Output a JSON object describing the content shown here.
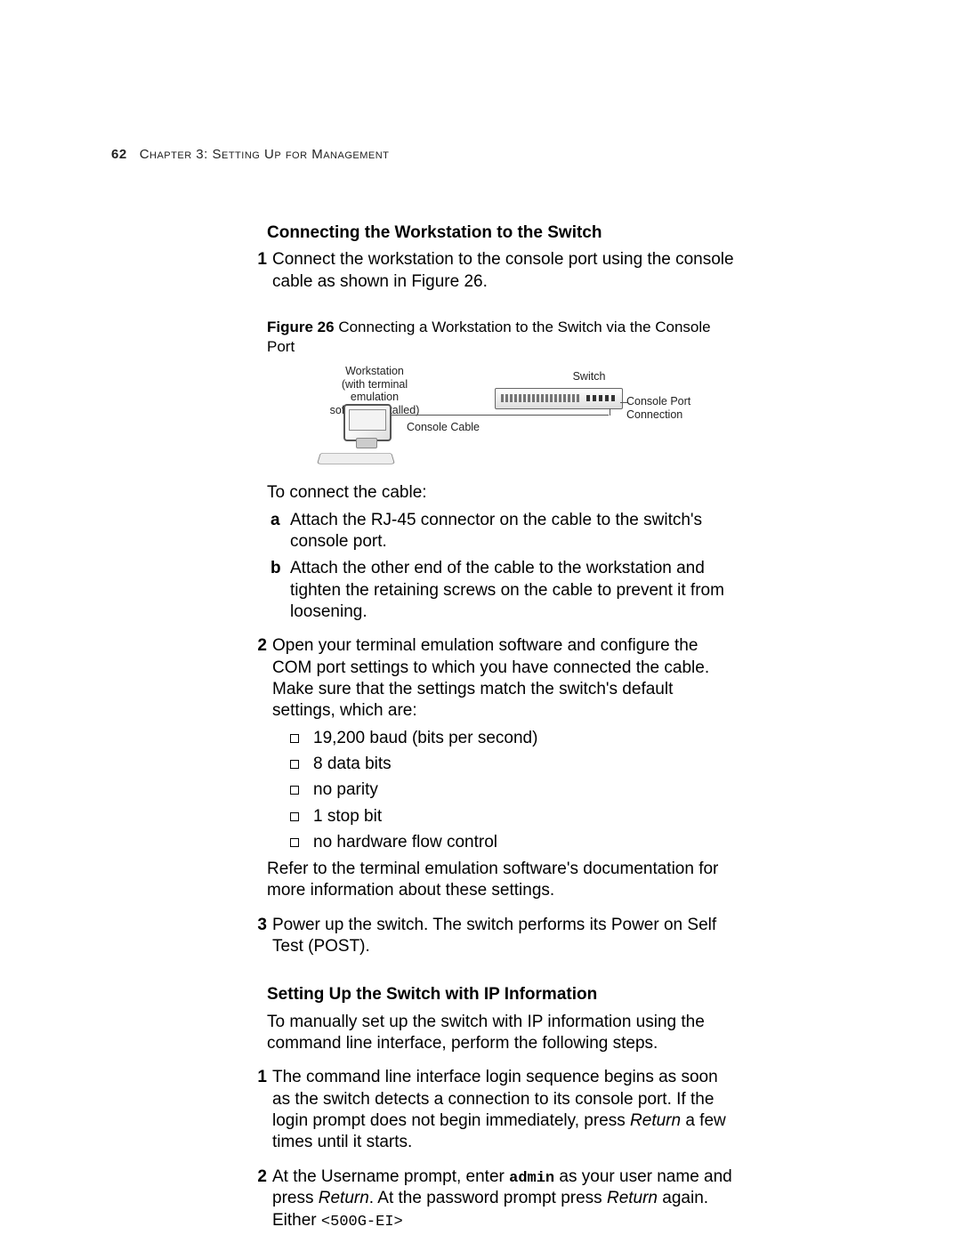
{
  "page_number": "62",
  "running_head": "Chapter 3: Setting Up for Management",
  "section1_title": "Connecting the Workstation to the Switch",
  "step1_num": "1",
  "step1_text": "Connect the workstation to the console port using the console cable as shown in Figure 26.",
  "fig_label": "Figure 26",
  "fig_caption": "   Connecting a Workstation to the Switch via the Console Port",
  "fig_workstation_l1": "Workstation",
  "fig_workstation_l2": "(with terminal emulation",
  "fig_workstation_l3": "software installed)",
  "fig_switch": "Switch",
  "fig_console_cable": "Console Cable",
  "fig_console_port_l1": "Console Port",
  "fig_console_port_l2": "Connection",
  "cable_intro": "To connect the cable:",
  "sub_a": "a",
  "sub_a_text": "Attach the RJ-45 connector on the cable to the switch's console port.",
  "sub_b": "b",
  "sub_b_text": "Attach the other end of the cable to the workstation and tighten the retaining screws on the cable to prevent it from loosening.",
  "step2_num": "2",
  "step2_text": "Open your terminal emulation software and configure the COM port settings to which you have connected the cable. Make sure that the settings match the switch's default settings, which are:",
  "bullets": [
    "19,200 baud (bits per second)",
    "8 data bits",
    "no parity",
    "1 stop bit",
    "no hardware flow control"
  ],
  "step2_tail": "Refer to the terminal emulation software's documentation for more information about these settings.",
  "step3_num": "3",
  "step3_text": "Power up the switch. The switch performs its Power on Self Test (POST).",
  "section2_title": "Setting Up the Switch with IP Information",
  "section2_intro": "To manually set up the switch with IP information using the command line interface, perform the following steps.",
  "ip_step1_num": "1",
  "ip_step1_a": "The command line interface login sequence begins as soon as the switch detects a connection to its console port. If the login prompt does not begin immediately, press ",
  "ip_step1_ret": "Return",
  "ip_step1_b": " a few times until it starts.",
  "ip_step2_num": "2",
  "ip_step2_a": "At the Username prompt, enter ",
  "ip_step2_admin": "admin",
  "ip_step2_b": " as your user name and press ",
  "ip_step2_ret1": "Return",
  "ip_step2_c": ". At the password prompt press ",
  "ip_step2_ret2": "Return",
  "ip_step2_d": " again. Either ",
  "ip_step2_prompt": "<500G-EI>"
}
